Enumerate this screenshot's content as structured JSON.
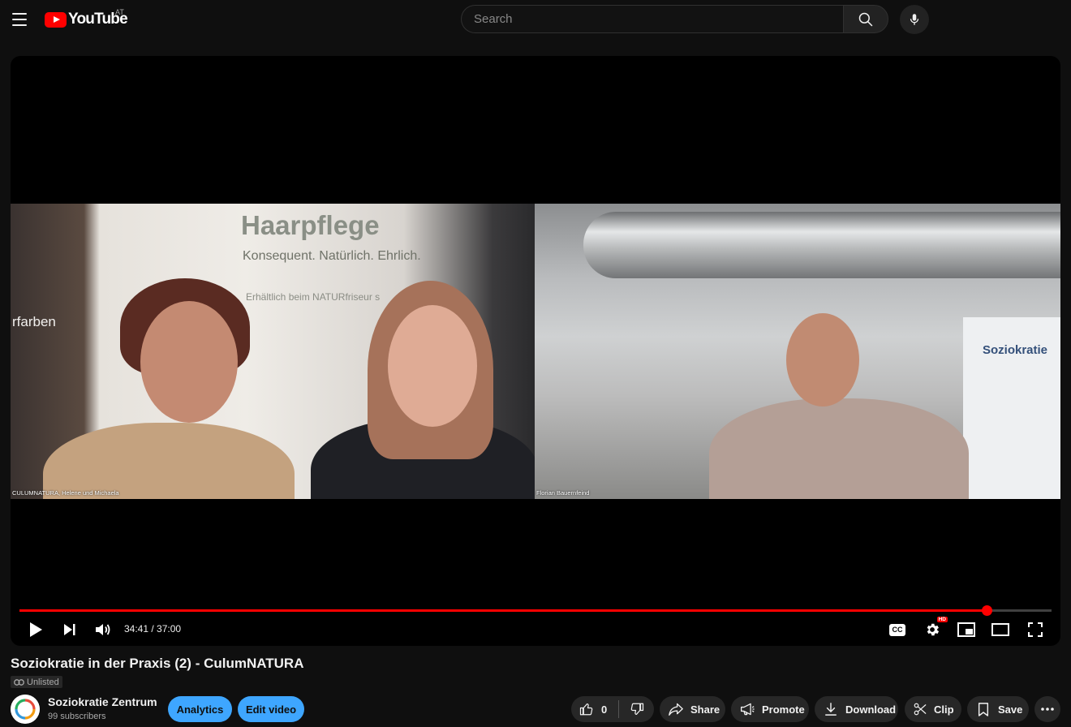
{
  "header": {
    "logo_text": "YouTube",
    "region": "AT",
    "search_placeholder": "Search"
  },
  "video": {
    "left_tile_label": "CULUMNATURA, Helene und Michaela",
    "right_tile_label": "Florian Bauernfeind",
    "banner_title": "Haarpflege",
    "banner_subtitle": "Konsequent. Natürlich. Ehrlich.",
    "banner_note": "Erhältlich beim NATURfriseur s",
    "poster_fragment": "rfarben",
    "sign_text": "Soziokratie"
  },
  "player": {
    "current_time": "34:41",
    "duration": "37:00",
    "time_display": "34:41 / 37:00",
    "progress": 0.937,
    "cc_label": "CC",
    "hd_badge": "HD"
  },
  "details": {
    "title": "Soziokratie in der Praxis (2) - CulumNATURA",
    "visibility": "Unlisted",
    "channel_name": "Soziokratie Zentrum",
    "subscribers": "99 subscribers",
    "analytics_label": "Analytics",
    "edit_label": "Edit video",
    "like_count": "0",
    "share_label": "Share",
    "promote_label": "Promote",
    "download_label": "Download",
    "clip_label": "Clip",
    "save_label": "Save"
  },
  "colors": {
    "accent": "#ff0000",
    "button_blue": "#3ea6ff",
    "background": "#0f0f0f",
    "pill": "#272727"
  }
}
